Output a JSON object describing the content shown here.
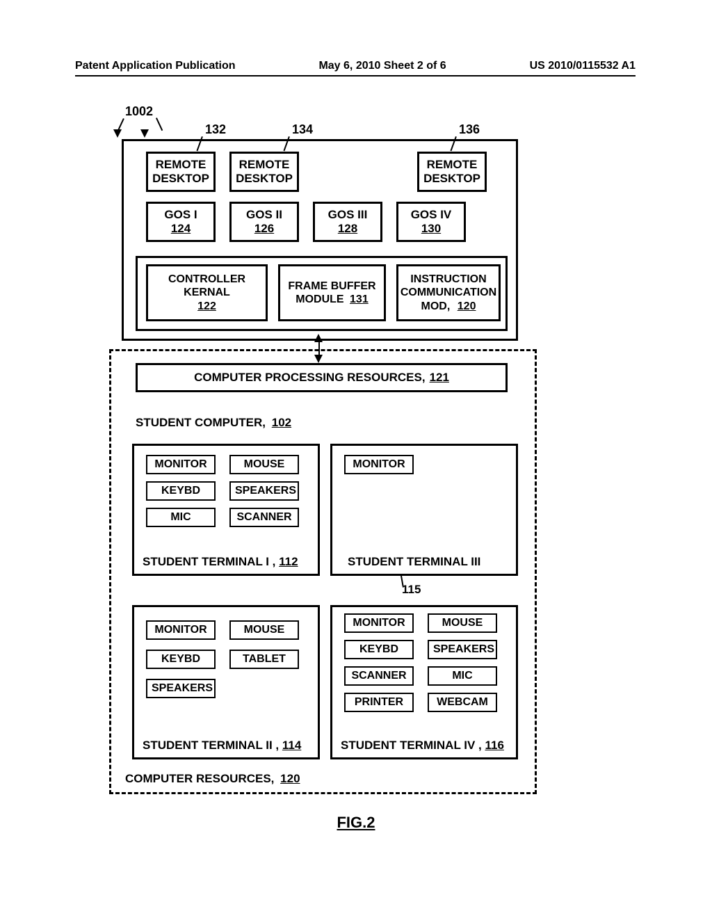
{
  "header": {
    "left": "Patent Application Publication",
    "center": "May 6, 2010  Sheet 2 of 6",
    "right": "US 2010/0115532 A1"
  },
  "figure_label": "FIG.2",
  "leads": {
    "l1002": "1002",
    "l132": "132",
    "l134": "134",
    "l136": "136",
    "l115": "115"
  },
  "top": {
    "rd1": "REMOTE\nDESKTOP",
    "rd2": "REMOTE\nDESKTOP",
    "rd3": "REMOTE\nDESKTOP",
    "gos1": {
      "name": "GOS I",
      "num": "124"
    },
    "gos2": {
      "name": "GOS II",
      "num": "126"
    },
    "gos3": {
      "name": "GOS III",
      "num": "128"
    },
    "gos4": {
      "name": "GOS IV",
      "num": "130"
    },
    "kernel": {
      "l1": "CONTROLLER",
      "l2": "KERNAL",
      "num": "122"
    },
    "fb": {
      "l1": "FRAME BUFFER",
      "l2": "MODULE",
      "num": "131"
    },
    "icm": {
      "l1": "INSTRUCTION",
      "l2": "COMMUNICATION",
      "l3": "MOD,",
      "num": "120"
    }
  },
  "cpr": {
    "label": "COMPUTER PROCESSING RESOURCES,",
    "num": "121"
  },
  "student_computer": {
    "label": "STUDENT COMPUTER,",
    "num": "102"
  },
  "t1": {
    "label": "STUDENT TERMINAL I  ,",
    "num": "112",
    "dev": [
      "MONITOR",
      "MOUSE",
      "KEYBD",
      "SPEAKERS",
      "MIC",
      "SCANNER"
    ]
  },
  "t2": {
    "label": "STUDENT TERMINAL II ,",
    "num": "114",
    "dev": [
      "MONITOR",
      "MOUSE",
      "KEYBD",
      "TABLET",
      "SPEAKERS"
    ]
  },
  "t3": {
    "label": "STUDENT TERMINAL III",
    "dev": [
      "MONITOR"
    ]
  },
  "t4": {
    "label": "STUDENT TERMINAL IV ,",
    "num": "116",
    "dev": [
      "MONITOR",
      "MOUSE",
      "KEYBD",
      "SPEAKERS",
      "SCANNER",
      "MIC",
      "PRINTER",
      "WEBCAM"
    ]
  },
  "resources": {
    "label": "COMPUTER RESOURCES,",
    "num": "120"
  }
}
